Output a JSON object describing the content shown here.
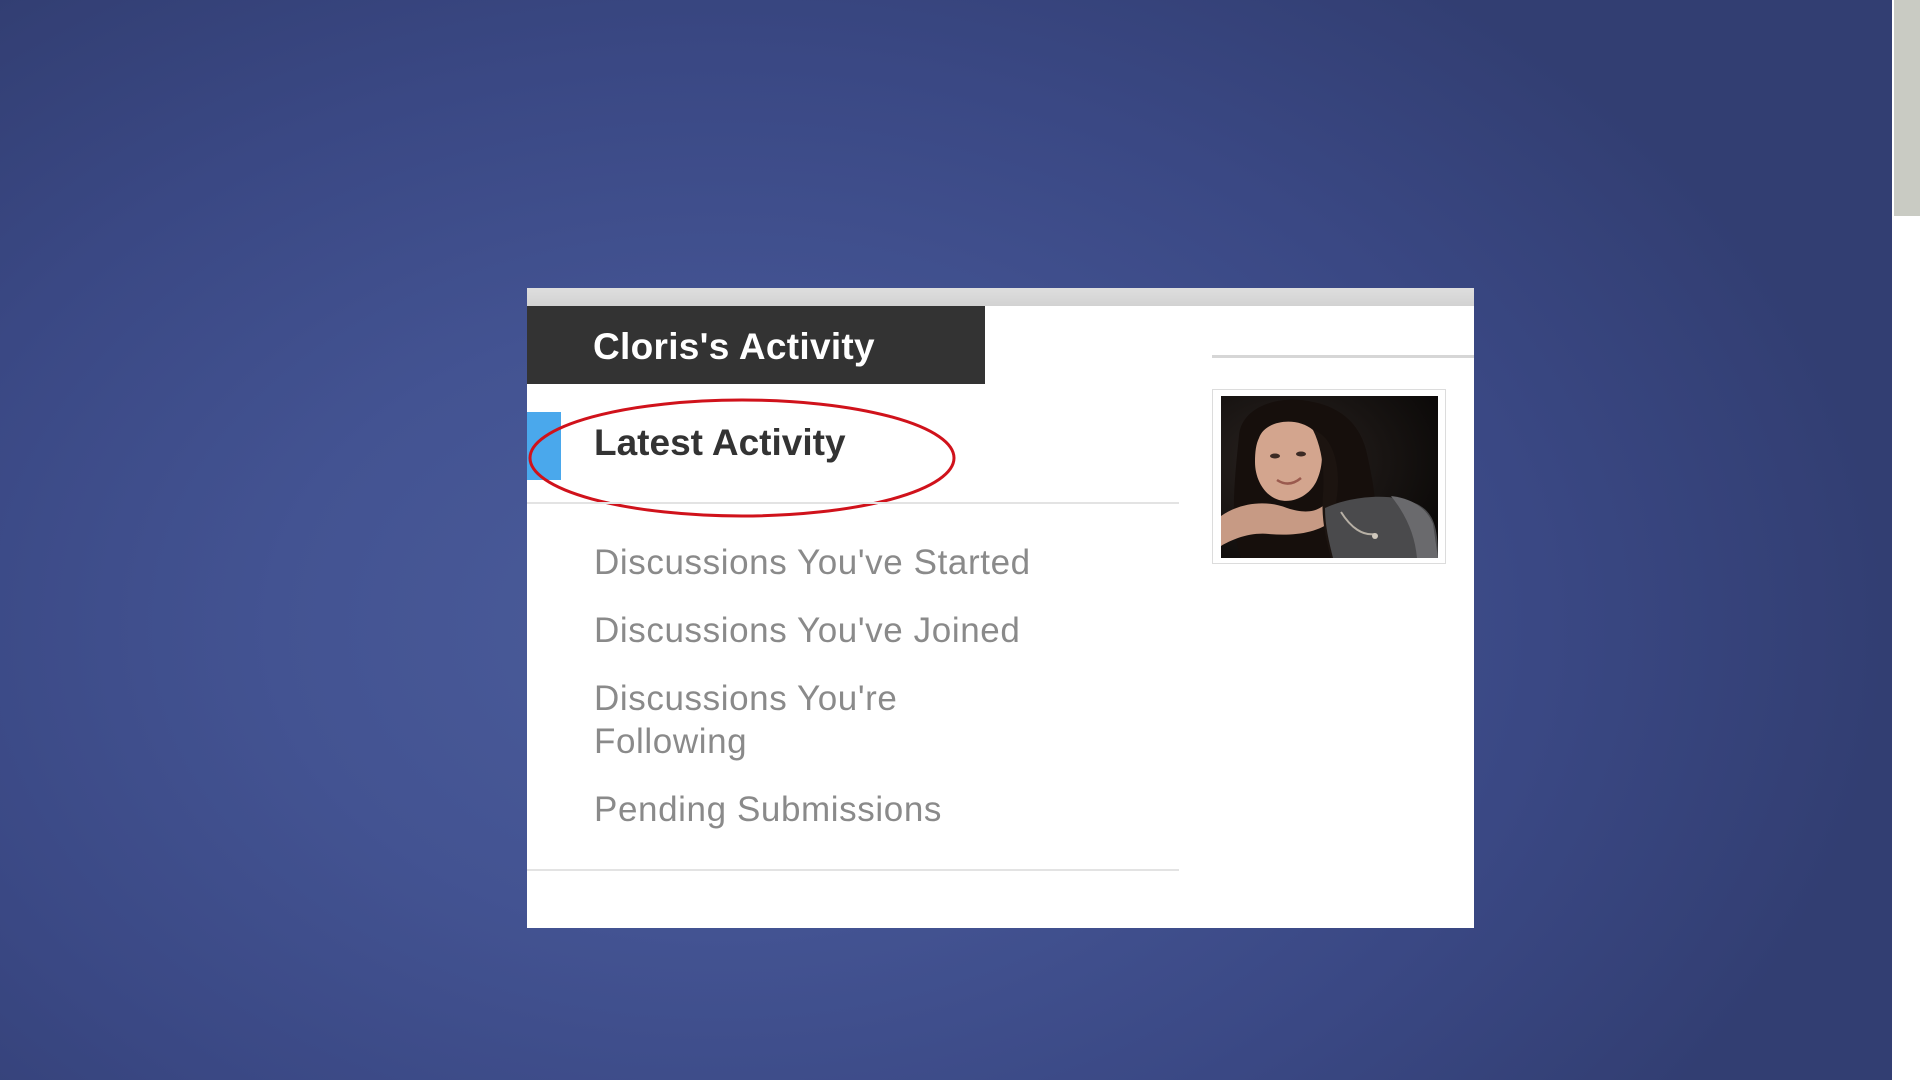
{
  "panel": {
    "title": "Cloris's Activity",
    "active_item": "Latest Activity",
    "nav_items": [
      "Discussions You've Started",
      "Discussions You've Joined",
      "Discussions You're Following",
      "Pending Submissions"
    ]
  },
  "colors": {
    "background": "#3f4f8e",
    "title_tab": "#333333",
    "active_marker": "#4aa8ec",
    "highlight_circle": "#d0121b",
    "nav_text": "#8a8a8a"
  },
  "icons": {
    "avatar": "profile-photo"
  }
}
